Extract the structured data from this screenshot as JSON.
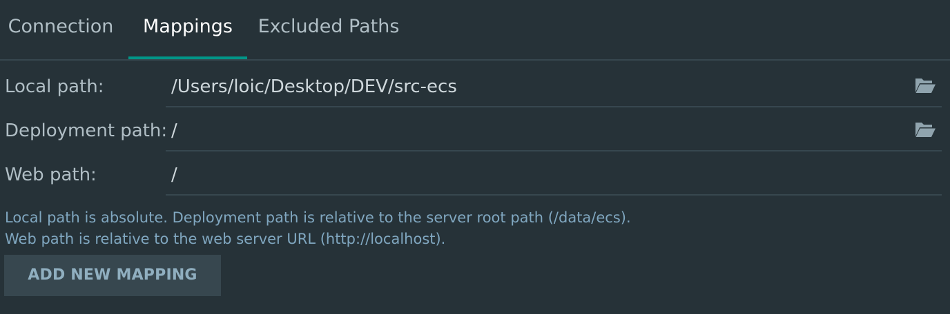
{
  "tabs": [
    {
      "label": "Connection"
    },
    {
      "label": "Mappings"
    },
    {
      "label": "Excluded Paths"
    }
  ],
  "active_tab": "Mappings",
  "fields": {
    "local_path": {
      "label": "Local path:",
      "value": "/Users/loic/Desktop/DEV/src-ecs"
    },
    "deployment_path": {
      "label": "Deployment path:",
      "value": "/"
    },
    "web_path": {
      "label": "Web path:",
      "value": "/"
    }
  },
  "help": {
    "line1": "Local path is absolute. Deployment path is relative to the server root path (/data/ecs).",
    "line2": "Web path is relative to the web server URL (http://localhost)."
  },
  "add_button_label": "ADD NEW MAPPING",
  "colors": {
    "background": "#263238",
    "accent": "#009688",
    "divider": "#37474F",
    "text": "#B0BEC5",
    "active_text": "#FFFFFF",
    "help_text": "#80A7C0",
    "icon": "#90A4AE"
  },
  "icons": {
    "local_path_browse": "folder-open-icon",
    "deployment_path_browse": "folder-open-icon"
  }
}
